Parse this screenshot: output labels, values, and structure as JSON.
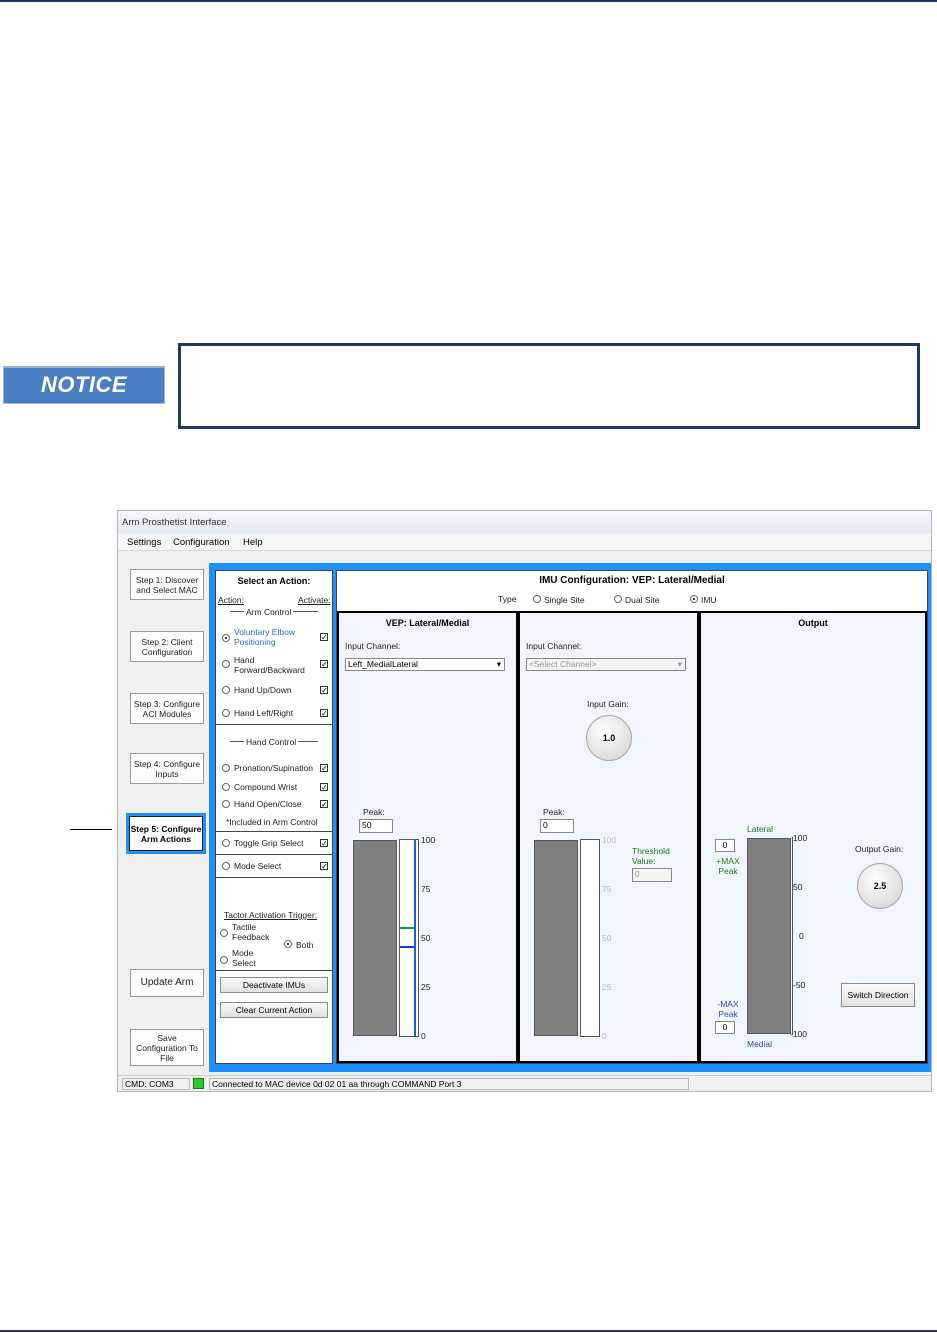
{
  "notice": {
    "label": "NOTICE"
  },
  "window": {
    "title": "Arm Prosthetist Interface",
    "menu": [
      "Settings",
      "Configuration",
      "Help"
    ]
  },
  "steps": [
    "Step 1: Discover and Select MAC",
    "Step 2: Client Configuration",
    "Step 3: Configure ACI Modules",
    "Step 4: Configure Inputs",
    "Step 5: Configure Arm Actions"
  ],
  "update_arm": "Update Arm",
  "save_config": "Save Configuration To File",
  "actions": {
    "title": "Select an Action:",
    "col_action": "Action:",
    "col_activate": "Activate:",
    "arm_group": "Arm Control",
    "arm_items": [
      "Voluntary Elbow Positioning",
      "Hand Forward/Backward",
      "Hand Up/Down",
      "Hand Left/Right"
    ],
    "hand_group": "Hand Control",
    "hand_items": [
      "Pronation/Supination",
      "Compound Wrist",
      "Hand Open/Close"
    ],
    "included_note": "*Included in Arm Control",
    "toggle_grip": "Toggle Grip Select",
    "mode_select": "Mode Select",
    "tactor_title": "Tactor Activation Trigger:",
    "tactile": "Tactile Feedback",
    "mode": "Mode Select",
    "both": "Both",
    "deactivate_imus": "Deactivate IMUs",
    "clear_action": "Clear Current Action"
  },
  "imu": {
    "title": "IMU Configuration: VEP: Lateral/Medial",
    "type_label": "Type",
    "type_options": [
      "Single Site",
      "Dual Site",
      "IMU"
    ],
    "type_selected": "IMU",
    "vep": {
      "title": "VEP: Lateral/Medial",
      "input_label": "Input Channel:",
      "input_value": "Left_MedialLateral",
      "peak_label": "Peak:",
      "peak_value": "50",
      "scale": [
        "100",
        "75",
        "50",
        "25",
        "0"
      ]
    },
    "second": {
      "input_label": "Input Channel:",
      "input_placeholder": "<Select Channel>",
      "gain_label": "Input Gain:",
      "gain_value": "1.0",
      "peak_label": "Peak:",
      "peak_value": "0",
      "threshold_label": "Threshold Value:",
      "threshold_value": "0",
      "scale": [
        "100",
        "75",
        "50",
        "25",
        "0"
      ]
    },
    "output": {
      "title": "Output",
      "lateral": "Lateral",
      "medial": "Medial",
      "max_peak": "+MAX Peak",
      "max_peak_value": "0",
      "min_peak": "-MAX Peak",
      "min_peak_value": "0",
      "gain_label": "Output Gain:",
      "gain_value": "2.5",
      "switch_direction": "Switch Direction",
      "scale": [
        "100",
        "50",
        "0",
        "-50",
        "-100"
      ]
    }
  },
  "status": {
    "cmd": "CMD: COM3",
    "message": "Connected to MAC device 0d 02 01 aa through COMMAND Port 3"
  }
}
